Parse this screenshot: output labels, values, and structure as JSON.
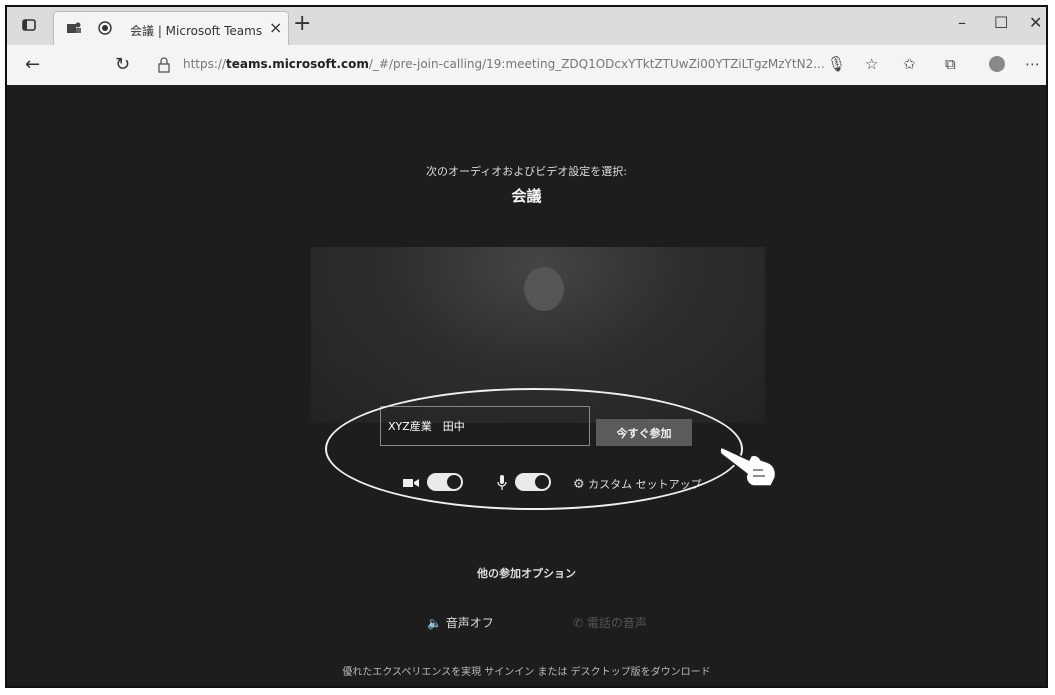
{
  "browser": {
    "tab_title": "会議 | Microsoft Teams",
    "new_tab_symbol": "+",
    "close_symbol": "×",
    "url_prefix": "https://",
    "url_domain": "teams.microsoft.com",
    "url_rest": "/_#/pre-join-calling/19:meeting_ZDQ1ODcxYTktZTUwZi00YTZiLTgzMzYtN2..."
  },
  "prejoin": {
    "prompt": "次のオーディオおよびビデオ設定を選択:",
    "meeting_title": "会議",
    "name_value": "XYZ産業　田中",
    "join_button": "今すぐ参加",
    "custom_setup": "カスタム セットアップ",
    "camera_on": true,
    "mic_on": true
  },
  "options": {
    "heading": "他の参加オプション",
    "audio_off": "音声オフ",
    "phone_audio": "電話の音声"
  },
  "footer": {
    "text": "優れたエクスペリエンスを実現 サインイン または デスクトップ版をダウンロード"
  }
}
